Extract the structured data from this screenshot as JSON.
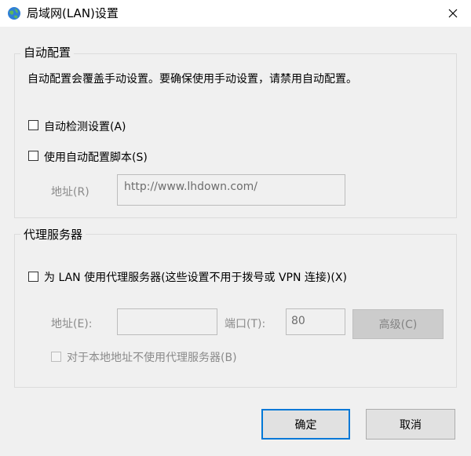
{
  "window": {
    "title": "局域网(LAN)设置",
    "icon": "network-globe-icon"
  },
  "auto_config": {
    "group_label": "自动配置",
    "description": "自动配置会覆盖手动设置。要确保使用手动设置，请禁用自动配置。",
    "auto_detect_label": "自动检测设置(A)",
    "auto_detect_checked": false,
    "use_script_label": "使用自动配置脚本(S)",
    "use_script_checked": false,
    "address_label": "地址(R)",
    "address_value": "http://www.lhdown.com/"
  },
  "proxy": {
    "group_label": "代理服务器",
    "use_proxy_label": "为 LAN 使用代理服务器(这些设置不用于拨号或 VPN 连接)(X)",
    "use_proxy_checked": false,
    "address_label": "地址(E):",
    "address_value": "",
    "port_label": "端口(T):",
    "port_value": "80",
    "advanced_label": "高级(C)",
    "bypass_label": "对于本地地址不使用代理服务器(B)",
    "bypass_checked": false
  },
  "buttons": {
    "ok_label": "确定",
    "cancel_label": "取消"
  }
}
